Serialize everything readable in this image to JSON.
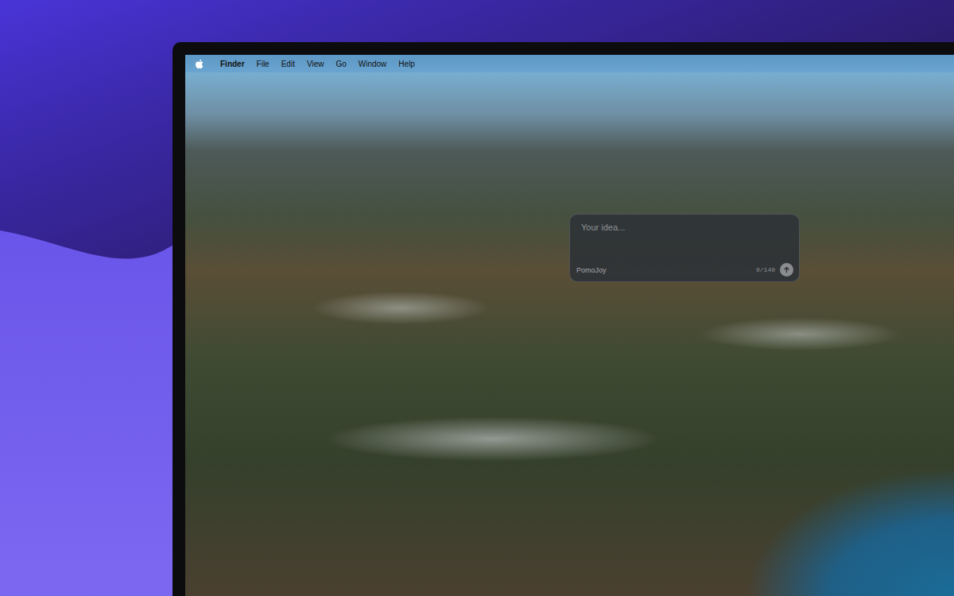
{
  "menu_bar": {
    "items": [
      {
        "label": "Finder",
        "kind": "app"
      },
      {
        "label": "File",
        "kind": "menu"
      },
      {
        "label": "Edit",
        "kind": "menu"
      },
      {
        "label": "View",
        "kind": "menu"
      },
      {
        "label": "Go",
        "kind": "menu"
      },
      {
        "label": "Window",
        "kind": "menu"
      },
      {
        "label": "Help",
        "kind": "menu"
      }
    ]
  },
  "idea_panel": {
    "placeholder": "Your idea...",
    "app_label": "PomoJoy",
    "counter": "0/140"
  }
}
